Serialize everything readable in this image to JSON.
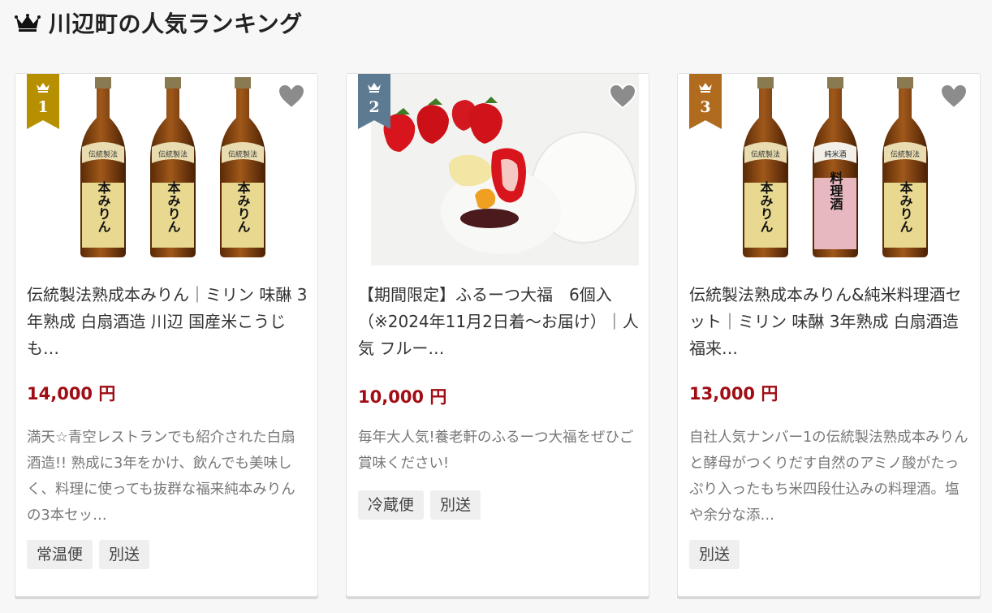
{
  "section": {
    "title": "川辺町の人気ランキング",
    "icon": "crown-icon"
  },
  "colors": {
    "rank_1": "#b69000",
    "rank_2": "#5c7a91",
    "rank_3": "#b06b1f",
    "price": "#a10d14"
  },
  "products": [
    {
      "rank": "1",
      "name": "伝統製法熟成本みりん｜ミリン 味醂 3年熟成 白扇酒造 川辺 国産米こうじ も…",
      "price": "14,000 円",
      "description": "満天☆青空レストランでも紹介された白扇酒造!! 熟成に3年をかけ、飲んでも美味しく、料理に使っても抜群な福来純本みりんの3本セッ…",
      "tags": [
        "常温便",
        "別送"
      ]
    },
    {
      "rank": "2",
      "name": "【期間限定】ふるーつ大福　6個入（※2024年11月2日着～お届け）｜人気 フルー…",
      "price": "10,000 円",
      "description": "毎年大人気!養老軒のふるーつ大福をぜひご賞味ください!",
      "tags": [
        "冷蔵便",
        "別送"
      ]
    },
    {
      "rank": "3",
      "name": "伝統製法熟成本みりん&純米料理酒セット｜ミリン 味醂 3年熟成 白扇酒造 福来…",
      "price": "13,000 円",
      "description": "自社人気ナンバー1の伝統製法熟成本みりんと酵母がつくりだす自然のアミノ酸がたっぷり入ったもち米四段仕込みの料理酒。塩や余分な添…",
      "tags": [
        "別送"
      ]
    }
  ],
  "bottle_labels": {
    "mirin_top": "伝統製法",
    "mirin_main": "本みりん",
    "sake_top": "純米酒",
    "sake_main": "料理酒"
  }
}
